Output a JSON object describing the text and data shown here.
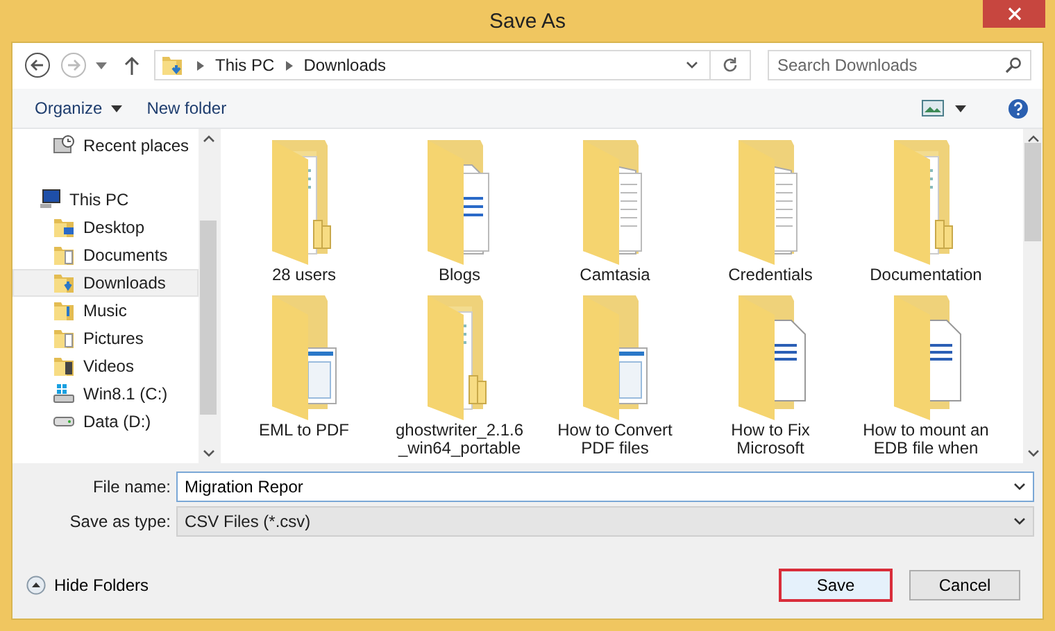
{
  "window": {
    "title": "Save As"
  },
  "address": {
    "path": [
      "This PC",
      "Downloads"
    ]
  },
  "search": {
    "placeholder": "Search Downloads"
  },
  "toolbar": {
    "organize": "Organize",
    "new_folder": "New folder"
  },
  "sidebar": {
    "items": [
      {
        "label": "Recent places",
        "kind": "recent",
        "selected": false
      },
      {
        "label": "This PC",
        "kind": "pc",
        "selected": false,
        "children": [
          {
            "label": "Desktop",
            "kind": "desktop",
            "selected": false
          },
          {
            "label": "Documents",
            "kind": "documents",
            "selected": false
          },
          {
            "label": "Downloads",
            "kind": "downloads",
            "selected": true
          },
          {
            "label": "Music",
            "kind": "music",
            "selected": false
          },
          {
            "label": "Pictures",
            "kind": "pictures",
            "selected": false
          },
          {
            "label": "Videos",
            "kind": "videos",
            "selected": false
          },
          {
            "label": "Win8.1 (C:)",
            "kind": "windrive",
            "selected": false
          },
          {
            "label": "Data (D:)",
            "kind": "drive",
            "selected": false
          }
        ]
      }
    ]
  },
  "folders": [
    {
      "name": "28 users",
      "kind": "tabs"
    },
    {
      "name": "Blogs",
      "kind": "pages"
    },
    {
      "name": "Camtasia",
      "kind": "lined"
    },
    {
      "name": "Credentials",
      "kind": "lined"
    },
    {
      "name": "Documentation",
      "kind": "tabs"
    },
    {
      "name": "EML to PDF",
      "kind": "screens"
    },
    {
      "name": "ghostwriter_2.1.6 _win64_portable",
      "kind": "tabs"
    },
    {
      "name": "How to Convert PDF files",
      "kind": "screens"
    },
    {
      "name": "How to Fix Microsoft",
      "kind": "word"
    },
    {
      "name": "How to mount an EDB file when",
      "kind": "word"
    }
  ],
  "file_name": {
    "label": "File name:",
    "value": "Migration Repor"
  },
  "save_type": {
    "label": "Save as type:",
    "value": "CSV Files (*.csv)"
  },
  "hide_folders": "Hide Folders",
  "buttons": [
    {
      "label": "Save",
      "focused": true
    },
    {
      "label": "Cancel",
      "focused": false
    }
  ]
}
